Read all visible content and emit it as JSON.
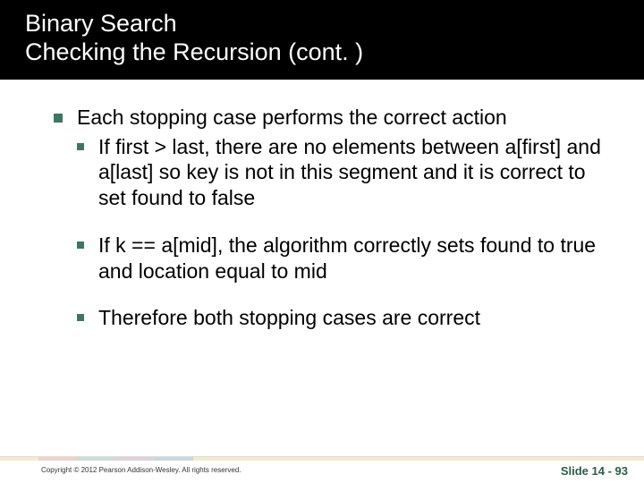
{
  "title": {
    "line1": "Binary Search",
    "line2": "Checking the Recursion (cont. )"
  },
  "bullets": {
    "main": "Each stopping case performs the correct action",
    "sub1": "If first > last, there are no elements between a[first] and a[last] so key is not in this segment and it is correct to set found to false",
    "sub2": "If k == a[mid], the algorithm correctly sets found to true and location equal to mid",
    "sub3": "Therefore both stopping cases are correct"
  },
  "footer": {
    "copyright": "Copyright © 2012 Pearson Addison-Wesley.  All rights reserved.",
    "slide": "Slide 14 - 93"
  }
}
